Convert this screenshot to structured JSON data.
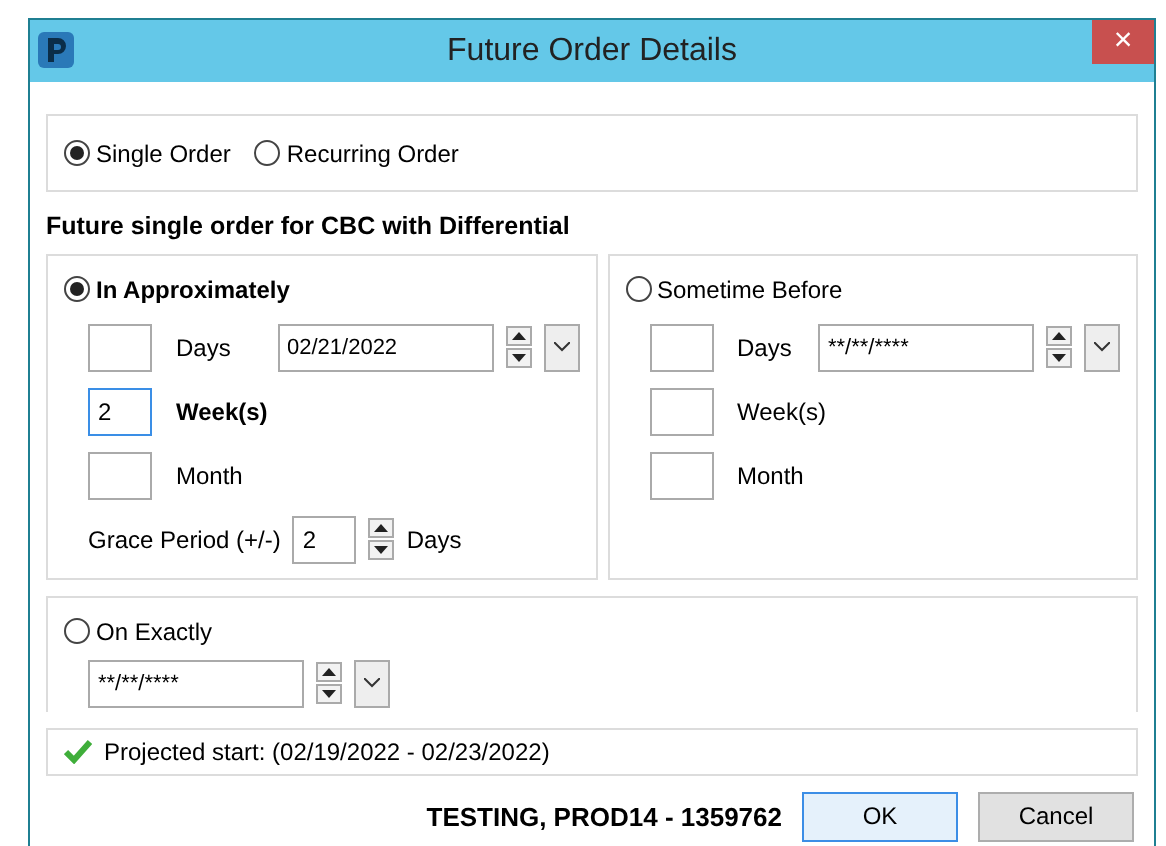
{
  "window": {
    "title": "Future Order Details",
    "close": "×"
  },
  "order_types": [
    {
      "label": "Single Order",
      "selected": true
    },
    {
      "label": "Recurring Order",
      "selected": false
    }
  ],
  "heading": "Future single order for CBC with Differential",
  "options": [
    {
      "label": "In Approximately",
      "selected": true,
      "date": "02/21/2022",
      "units": [
        {
          "label": "Days",
          "emphasized": false,
          "focused": false
        },
        {
          "label": "Week(s)",
          "value": "2",
          "emphasized": true,
          "focused": true
        },
        {
          "label": "Month",
          "emphasized": false,
          "focused": false
        }
      ],
      "grace": {
        "label": "Grace Period (+/-)",
        "value": "2",
        "unit": "Days"
      }
    },
    {
      "label": "Sometime Before",
      "selected": false,
      "date": "**/**/****",
      "units": [
        {
          "label": "Days",
          "emphasized": false,
          "focused": false
        },
        {
          "label": "Week(s)",
          "emphasized": false,
          "focused": false
        },
        {
          "label": "Month",
          "emphasized": false,
          "focused": false
        }
      ]
    }
  ],
  "on_exactly": {
    "label": "On Exactly",
    "selected": false,
    "date": "**/**/****"
  },
  "projected": "Projected start: (02/19/2022 - 02/23/2022)",
  "patient": "TESTING, PROD14 - 1359762",
  "buttons": [
    {
      "label": "OK",
      "default": true
    },
    {
      "label": "Cancel",
      "default": false
    }
  ]
}
